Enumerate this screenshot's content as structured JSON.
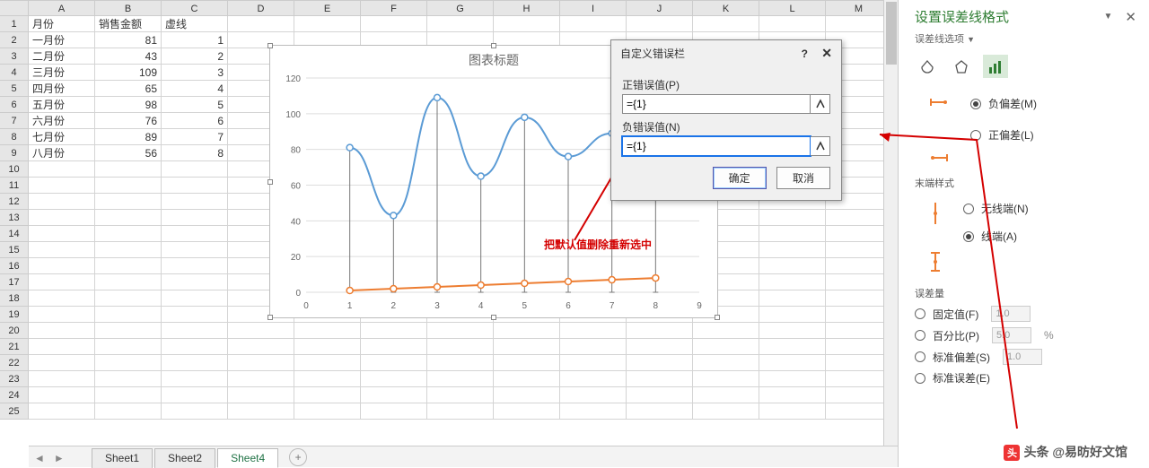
{
  "columns": [
    "A",
    "B",
    "C",
    "D",
    "E",
    "F",
    "G",
    "H",
    "I",
    "J",
    "K",
    "L",
    "M"
  ],
  "row_count": 25,
  "headers": {
    "A": "月份",
    "B": "销售金额",
    "C": "虚线"
  },
  "rows": [
    {
      "A": "一月份",
      "B": 81,
      "C": 1
    },
    {
      "A": "二月份",
      "B": 43,
      "C": 2
    },
    {
      "A": "三月份",
      "B": 109,
      "C": 3
    },
    {
      "A": "四月份",
      "B": 65,
      "C": 4
    },
    {
      "A": "五月份",
      "B": 98,
      "C": 5
    },
    {
      "A": "六月份",
      "B": 76,
      "C": 6
    },
    {
      "A": "七月份",
      "B": 89,
      "C": 7
    },
    {
      "A": "八月份",
      "B": 56,
      "C": 8
    }
  ],
  "chart_data": {
    "type": "line",
    "title": "图表标题",
    "xlabel": "",
    "ylabel": "",
    "xticks": [
      0,
      1,
      2,
      3,
      4,
      5,
      6,
      7,
      8,
      9
    ],
    "yticks": [
      0,
      20,
      40,
      60,
      80,
      100,
      120
    ],
    "xlim": [
      0,
      9
    ],
    "ylim": [
      0,
      120
    ],
    "series": [
      {
        "name": "销售金额",
        "x": [
          1,
          2,
          3,
          4,
          5,
          6,
          7,
          8
        ],
        "values": [
          81,
          43,
          109,
          65,
          98,
          76,
          89,
          56
        ],
        "color": "#5b9bd5",
        "smooth": true,
        "error_bars": "minus_to_axis"
      },
      {
        "name": "虚线",
        "x": [
          1,
          2,
          3,
          4,
          5,
          6,
          7,
          8
        ],
        "values": [
          1,
          2,
          3,
          4,
          5,
          6,
          7,
          8
        ],
        "color": "#ed7d31",
        "smooth": false
      }
    ]
  },
  "annotation": "把默认值删除重新选中",
  "dialog": {
    "title": "自定义错误栏",
    "help": "?",
    "close": "✕",
    "pos_label": "正错误值(P)",
    "pos_value": "={1}",
    "neg_label": "负错误值(N)",
    "neg_value": "={1}",
    "ok": "确定",
    "cancel": "取消"
  },
  "pane": {
    "title": "设置误差线格式",
    "close": "✕",
    "subtitle": "误差线选项",
    "section_dir_sel": "负偏差(M)",
    "section_dir_other": "正偏差(L)",
    "end_title": "末端样式",
    "end_opts": [
      "无线端(N)",
      "线端(A)"
    ],
    "end_sel": "线端(A)",
    "amount_title": "误差量",
    "amount_rows": [
      {
        "label": "固定值(F)",
        "val": "1.0"
      },
      {
        "label": "百分比(P)",
        "val": "5.0",
        "suffix": "%"
      },
      {
        "label": "标准偏差(S)",
        "val": "1.0"
      },
      {
        "label": "标准误差(E)"
      }
    ]
  },
  "tabs": {
    "sheets": [
      "Sheet1",
      "Sheet2",
      "Sheet4"
    ],
    "active": "Sheet4",
    "add": "+"
  },
  "watermark": "头条 @易昉好文馆"
}
